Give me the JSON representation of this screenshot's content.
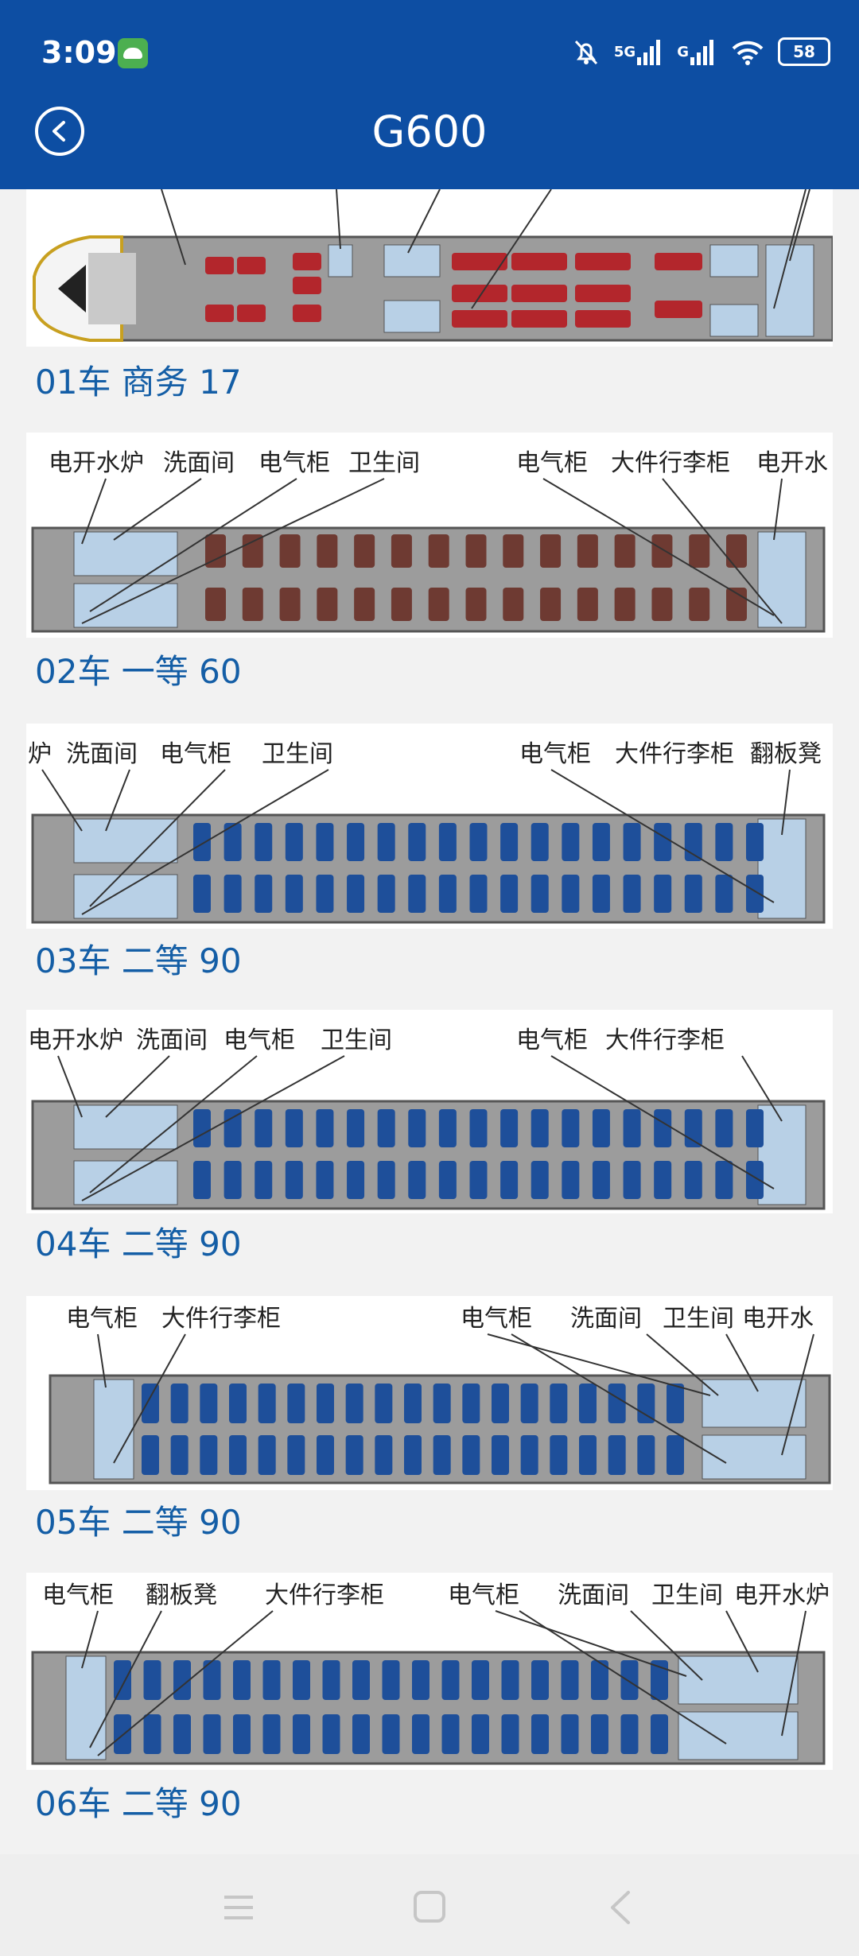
{
  "status_bar": {
    "time": "3:09",
    "network_a": "5G",
    "network_b": "G",
    "battery": "58",
    "icons": [
      "android-icon",
      "bell-muted-icon",
      "signal-icon",
      "signal-icon",
      "wifi-icon",
      "battery-icon"
    ]
  },
  "header": {
    "title": "G600",
    "back_icon": "back-arrow-icon"
  },
  "cars": [
    {
      "caption": "01车 商务 17",
      "labels": []
    },
    {
      "caption": "02车 一等 60",
      "labels": [
        "电开水炉",
        "洗面间",
        "电气柜",
        "卫生间",
        "电气柜",
        "大件行李柜",
        "电开水"
      ]
    },
    {
      "caption": "03车 二等 90",
      "labels": [
        "炉",
        "洗面间",
        "电气柜",
        "卫生间",
        "电气柜",
        "大件行李柜",
        "翻板凳"
      ]
    },
    {
      "caption": "04车 二等 90",
      "labels": [
        "电开水炉",
        "洗面间",
        "电气柜",
        "卫生间",
        "电气柜",
        "大件行李柜"
      ]
    },
    {
      "caption": "05车 二等 90",
      "labels": [
        "电气柜",
        "大件行李柜",
        "电气柜",
        "洗面间",
        "卫生间",
        "电开水"
      ]
    },
    {
      "caption": "06车 二等 90",
      "labels": [
        "电气柜",
        "翻板凳",
        "大件行李柜",
        "电气柜",
        "洗面间",
        "卫生间",
        "电开水炉"
      ]
    }
  ],
  "nav_bar": {
    "icons": [
      "menu-icon",
      "home-square-icon",
      "back-triangle-icon"
    ]
  },
  "colors": {
    "header_bg": "#0d4ea3",
    "caption_text": "#145ea6",
    "business_seat": "#b3262c",
    "first_seat": "#6e3a32",
    "second_seat": "#1e4f9a"
  }
}
